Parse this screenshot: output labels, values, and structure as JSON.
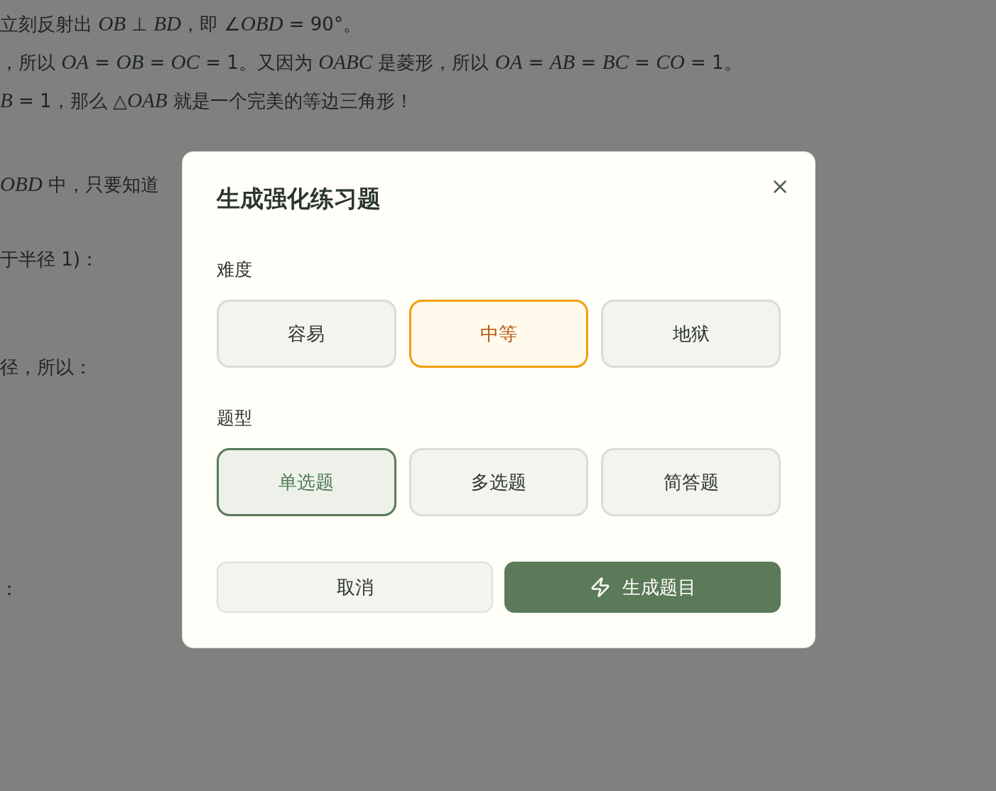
{
  "background_lines": [
    "立刻反射出 *OB* ⊥ *BD*，即 ∠*OBD* = 90°。",
    "，所以 *OA* = *OB* = *OC* = 1。又因为 *OABC* 是菱形，所以 *OA* = *AB* = *BC* = *CO* = 1。",
    "*B* = 1，那么 △*OAB* 就是一个完美的等边三角形！",
    "*OBD* 中，只要知道",
    "于半径 1)：",
    "径，所以：",
    "："
  ],
  "dialog": {
    "title": "生成强化练习题",
    "sections": [
      {
        "label": "难度",
        "kind": "difficulty",
        "options": [
          {
            "label": "容易",
            "selected": false
          },
          {
            "label": "中等",
            "selected": true
          },
          {
            "label": "地狱",
            "selected": false
          }
        ]
      },
      {
        "label": "题型",
        "kind": "type",
        "options": [
          {
            "label": "单选题",
            "selected": true
          },
          {
            "label": "多选题",
            "selected": false
          },
          {
            "label": "简答题",
            "selected": false
          }
        ]
      }
    ],
    "buttons": [
      {
        "label": "取消",
        "kind": "secondary"
      },
      {
        "label": "生成题目",
        "kind": "primary"
      }
    ]
  }
}
